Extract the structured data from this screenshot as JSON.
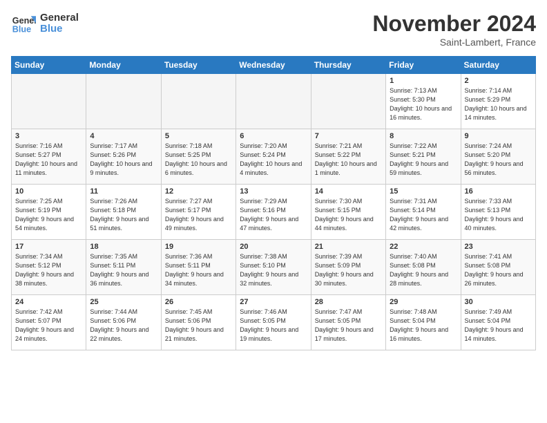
{
  "logo": {
    "line1": "General",
    "line2": "Blue"
  },
  "title": "November 2024",
  "location": "Saint-Lambert, France",
  "days_header": [
    "Sunday",
    "Monday",
    "Tuesday",
    "Wednesday",
    "Thursday",
    "Friday",
    "Saturday"
  ],
  "weeks": [
    [
      {
        "day": "",
        "empty": true
      },
      {
        "day": "",
        "empty": true
      },
      {
        "day": "",
        "empty": true
      },
      {
        "day": "",
        "empty": true
      },
      {
        "day": "",
        "empty": true
      },
      {
        "day": "1",
        "sunrise": "7:13 AM",
        "sunset": "5:30 PM",
        "daylight": "10 hours and 16 minutes."
      },
      {
        "day": "2",
        "sunrise": "7:14 AM",
        "sunset": "5:29 PM",
        "daylight": "10 hours and 14 minutes."
      }
    ],
    [
      {
        "day": "3",
        "sunrise": "7:16 AM",
        "sunset": "5:27 PM",
        "daylight": "10 hours and 11 minutes."
      },
      {
        "day": "4",
        "sunrise": "7:17 AM",
        "sunset": "5:26 PM",
        "daylight": "10 hours and 9 minutes."
      },
      {
        "day": "5",
        "sunrise": "7:18 AM",
        "sunset": "5:25 PM",
        "daylight": "10 hours and 6 minutes."
      },
      {
        "day": "6",
        "sunrise": "7:20 AM",
        "sunset": "5:24 PM",
        "daylight": "10 hours and 4 minutes."
      },
      {
        "day": "7",
        "sunrise": "7:21 AM",
        "sunset": "5:22 PM",
        "daylight": "10 hours and 1 minute."
      },
      {
        "day": "8",
        "sunrise": "7:22 AM",
        "sunset": "5:21 PM",
        "daylight": "9 hours and 59 minutes."
      },
      {
        "day": "9",
        "sunrise": "7:24 AM",
        "sunset": "5:20 PM",
        "daylight": "9 hours and 56 minutes."
      }
    ],
    [
      {
        "day": "10",
        "sunrise": "7:25 AM",
        "sunset": "5:19 PM",
        "daylight": "9 hours and 54 minutes."
      },
      {
        "day": "11",
        "sunrise": "7:26 AM",
        "sunset": "5:18 PM",
        "daylight": "9 hours and 51 minutes."
      },
      {
        "day": "12",
        "sunrise": "7:27 AM",
        "sunset": "5:17 PM",
        "daylight": "9 hours and 49 minutes."
      },
      {
        "day": "13",
        "sunrise": "7:29 AM",
        "sunset": "5:16 PM",
        "daylight": "9 hours and 47 minutes."
      },
      {
        "day": "14",
        "sunrise": "7:30 AM",
        "sunset": "5:15 PM",
        "daylight": "9 hours and 44 minutes."
      },
      {
        "day": "15",
        "sunrise": "7:31 AM",
        "sunset": "5:14 PM",
        "daylight": "9 hours and 42 minutes."
      },
      {
        "day": "16",
        "sunrise": "7:33 AM",
        "sunset": "5:13 PM",
        "daylight": "9 hours and 40 minutes."
      }
    ],
    [
      {
        "day": "17",
        "sunrise": "7:34 AM",
        "sunset": "5:12 PM",
        "daylight": "9 hours and 38 minutes."
      },
      {
        "day": "18",
        "sunrise": "7:35 AM",
        "sunset": "5:11 PM",
        "daylight": "9 hours and 36 minutes."
      },
      {
        "day": "19",
        "sunrise": "7:36 AM",
        "sunset": "5:11 PM",
        "daylight": "9 hours and 34 minutes."
      },
      {
        "day": "20",
        "sunrise": "7:38 AM",
        "sunset": "5:10 PM",
        "daylight": "9 hours and 32 minutes."
      },
      {
        "day": "21",
        "sunrise": "7:39 AM",
        "sunset": "5:09 PM",
        "daylight": "9 hours and 30 minutes."
      },
      {
        "day": "22",
        "sunrise": "7:40 AM",
        "sunset": "5:08 PM",
        "daylight": "9 hours and 28 minutes."
      },
      {
        "day": "23",
        "sunrise": "7:41 AM",
        "sunset": "5:08 PM",
        "daylight": "9 hours and 26 minutes."
      }
    ],
    [
      {
        "day": "24",
        "sunrise": "7:42 AM",
        "sunset": "5:07 PM",
        "daylight": "9 hours and 24 minutes."
      },
      {
        "day": "25",
        "sunrise": "7:44 AM",
        "sunset": "5:06 PM",
        "daylight": "9 hours and 22 minutes."
      },
      {
        "day": "26",
        "sunrise": "7:45 AM",
        "sunset": "5:06 PM",
        "daylight": "9 hours and 21 minutes."
      },
      {
        "day": "27",
        "sunrise": "7:46 AM",
        "sunset": "5:05 PM",
        "daylight": "9 hours and 19 minutes."
      },
      {
        "day": "28",
        "sunrise": "7:47 AM",
        "sunset": "5:05 PM",
        "daylight": "9 hours and 17 minutes."
      },
      {
        "day": "29",
        "sunrise": "7:48 AM",
        "sunset": "5:04 PM",
        "daylight": "9 hours and 16 minutes."
      },
      {
        "day": "30",
        "sunrise": "7:49 AM",
        "sunset": "5:04 PM",
        "daylight": "9 hours and 14 minutes."
      }
    ]
  ]
}
